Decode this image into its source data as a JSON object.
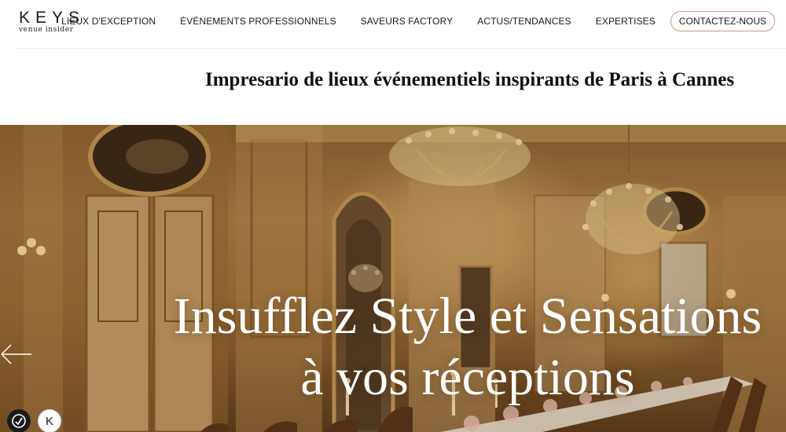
{
  "brand": {
    "name": "KEYS",
    "tagline": "venue insider"
  },
  "nav": {
    "items": [
      {
        "label": "LIEUX D'EXCEPTION"
      },
      {
        "label": "ÉVÉNEMENTS PROFESSIONNELS"
      },
      {
        "label": "SAVEURS FACTORY"
      },
      {
        "label": "ACTUS/TENDANCES"
      },
      {
        "label": "EXPERTISES"
      }
    ],
    "cta": "CONTACTEZ-NOUS"
  },
  "intro": {
    "subtitle": "Impresario de lieux événementiels inspirants de Paris à Cannes"
  },
  "hero": {
    "line1": "Insufflez Style et Sensations",
    "line2": "à vos réceptions",
    "image_icon": "salon-chandelier-image",
    "k_button": "K"
  },
  "colors": {
    "cta_border": "#c79a86",
    "hero_gold": "#b08147",
    "text": "#1a1a1a"
  }
}
